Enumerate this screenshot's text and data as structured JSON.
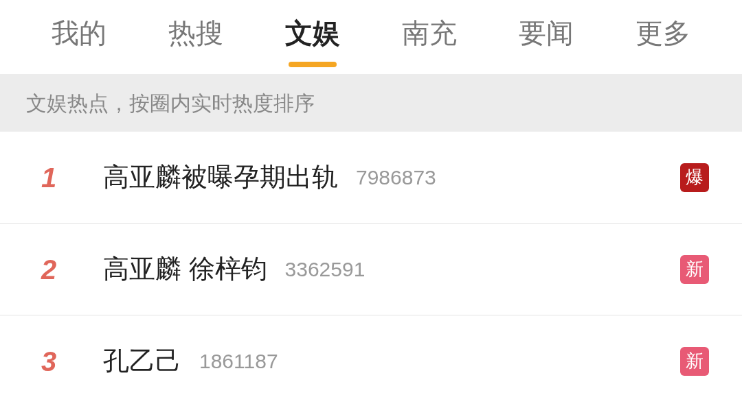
{
  "tabs": [
    {
      "label": "我的",
      "selected": false
    },
    {
      "label": "热搜",
      "selected": false
    },
    {
      "label": "文娱",
      "selected": true
    },
    {
      "label": "南充",
      "selected": false
    },
    {
      "label": "要闻",
      "selected": false
    },
    {
      "label": "更多",
      "selected": false
    }
  ],
  "notice": "文娱热点，按圈内实时热度排序",
  "rows": [
    {
      "rank": "1",
      "title": "高亚麟被曝孕期出轨",
      "count": "7986873",
      "badge": "爆",
      "color": "#b81c1c"
    },
    {
      "rank": "2",
      "title": "高亚麟 徐梓钧",
      "count": "3362591",
      "badge": "新",
      "color": "#e85a75"
    },
    {
      "rank": "3",
      "title": "孔乙己",
      "count": "1861187",
      "badge": "新",
      "color": "#e85a75"
    }
  ]
}
